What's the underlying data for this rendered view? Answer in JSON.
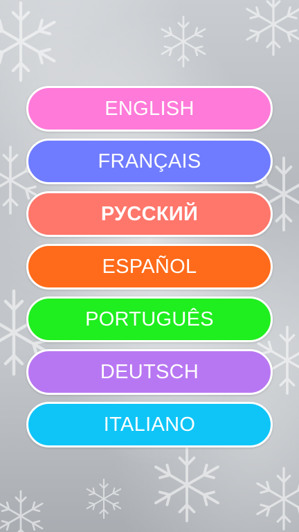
{
  "languages": [
    {
      "label": "ENGLISH",
      "color": "#ff7ad9"
    },
    {
      "label": "FRANÇAIS",
      "color": "#6f7cff"
    },
    {
      "label": "РУССКИЙ",
      "color": "#ff766b"
    },
    {
      "label": "ESPAÑOL",
      "color": "#ff6b1a"
    },
    {
      "label": "PORTUGUÊS",
      "color": "#1fee1f"
    },
    {
      "label": "DEUTSCH",
      "color": "#b877f2"
    },
    {
      "label": "ITALIANO",
      "color": "#0fc5f7"
    }
  ],
  "background": {
    "pattern": "snowflake-icon"
  }
}
